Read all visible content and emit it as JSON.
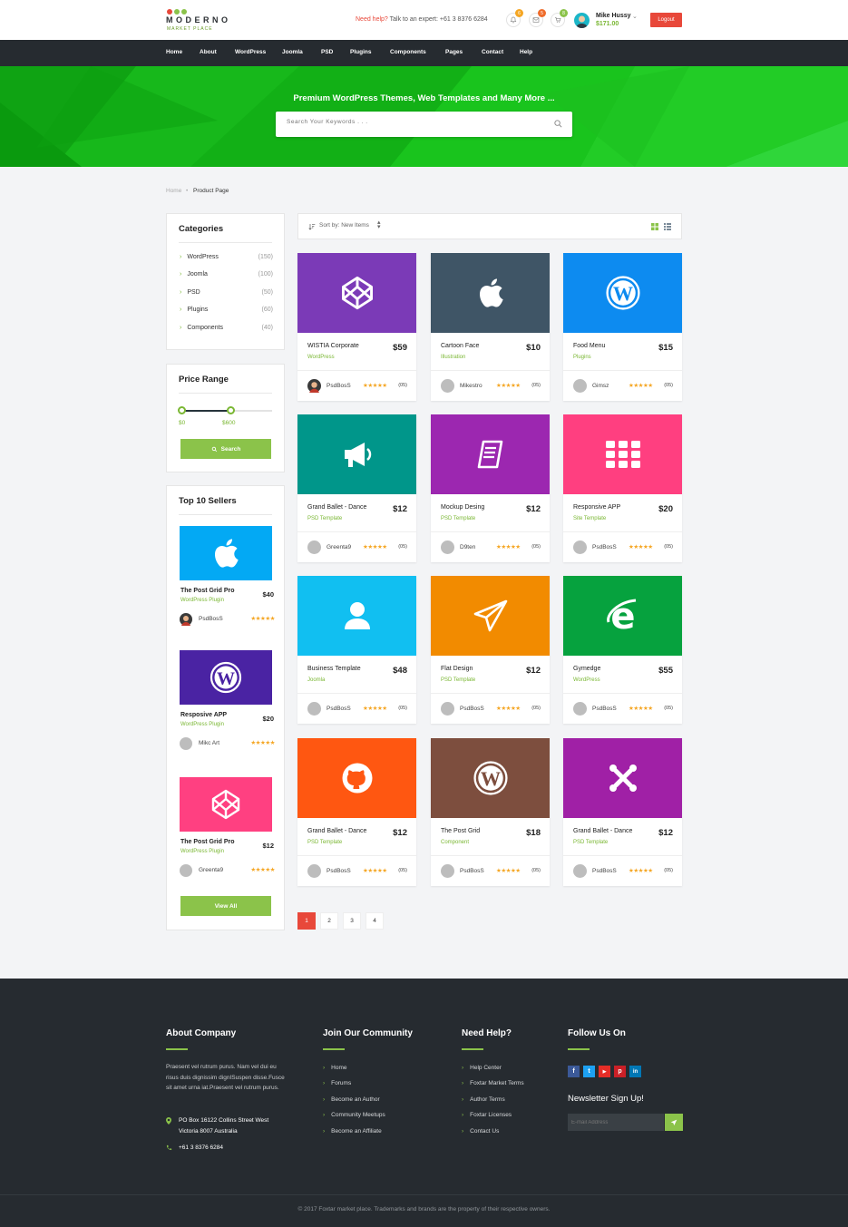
{
  "logo": {
    "title": "MODERNO",
    "subtitle": "MARKET PLACE",
    "dot_colors": [
      "#e8483a",
      "#8bc34a",
      "#8bc34a"
    ]
  },
  "header": {
    "help_prefix": "Need help?",
    "help_text": "Talk to an expert: +61 3 8376 6284",
    "notifications": [
      {
        "icon": "bell-icon",
        "badge": "6",
        "color": "#f5a623"
      },
      {
        "icon": "mail-icon",
        "badge": "5",
        "color": "#ef6c2b"
      },
      {
        "icon": "cart-icon",
        "badge": "8",
        "color": "#8bc34a"
      }
    ],
    "user_name": "Mike Hussy",
    "user_balance": "$171.00",
    "logout_label": "Logout"
  },
  "nav": [
    "Home",
    "About",
    "WordPress",
    "Joomla",
    "PSD",
    "Plugins",
    "Components",
    "Pages",
    "Contact",
    "Help"
  ],
  "hero": {
    "title": "Premium WordPress Themes, Web Templates and Many More ...",
    "search_placeholder": "Search Your Keywords . . ."
  },
  "breadcrumb": {
    "home": "Home",
    "current": "Product Page"
  },
  "categories": {
    "title": "Categories",
    "items": [
      {
        "label": "WordPress",
        "count": "(150)"
      },
      {
        "label": "Joomla",
        "count": "(100)"
      },
      {
        "label": "PSD",
        "count": "(50)"
      },
      {
        "label": "Plugins",
        "count": "(60)"
      },
      {
        "label": "Components",
        "count": "(40)"
      }
    ]
  },
  "price_range": {
    "title": "Price Range",
    "min_label": "$0",
    "max_label": "$600",
    "selected_fraction": 0.5,
    "button": "Search"
  },
  "top_sellers": {
    "title": "Top 10 Sellers",
    "items": [
      {
        "name": "The Post Grid Pro",
        "type": "WordPress Plugin",
        "price": "$40",
        "author": "PsdBosS",
        "color": "#03a9f4",
        "icon": "apple-icon",
        "stars": "★★★★★"
      },
      {
        "name": "Resposive APP",
        "type": "WordPress Plugin",
        "price": "$20",
        "author": "Mikc Art",
        "color": "#4a23a3",
        "icon": "wordpress-icon",
        "stars": "★★★★★"
      },
      {
        "name": "The Post Grid Pro",
        "type": "WordPress Plugin",
        "price": "$12",
        "author": "Greenta9",
        "color": "#ff4081",
        "icon": "codepen-icon",
        "stars": "★★★★★"
      }
    ],
    "button": "View All"
  },
  "sortbar": {
    "label": "Sort by: New Items"
  },
  "products": [
    {
      "name": "WISTIA Corporate",
      "type": "WordPress",
      "price": "$59",
      "author": "PsdBosS",
      "count": "05",
      "color": "#7b3ab7",
      "icon": "codepen-icon",
      "stars": "★★★★★"
    },
    {
      "name": "Cartoon Face",
      "type": "Illustration",
      "price": "$10",
      "author": "Mikestro",
      "count": "05",
      "color": "#3f5566",
      "icon": "apple-icon",
      "stars": "★★★★★"
    },
    {
      "name": "Food Menu",
      "type": "Plugins",
      "price": "$15",
      "author": "Gimsz",
      "count": "05",
      "color": "#0d8bf0",
      "icon": "wordpress-icon",
      "stars": "★★★★★"
    },
    {
      "name": "Grand Ballet - Dance",
      "type": "PSD Template",
      "price": "$12",
      "author": "Greenta9",
      "count": "05",
      "color": "#00968a",
      "icon": "megaphone-icon",
      "stars": "★★★★★"
    },
    {
      "name": "Mockup Desing",
      "type": "PSD Template",
      "price": "$12",
      "author": "D9ten",
      "count": "05",
      "color": "#9c27b0",
      "icon": "book-icon",
      "stars": "★★★★★"
    },
    {
      "name": "Responsive APP",
      "type": "Site Template",
      "price": "$20",
      "author": "PsdBosS",
      "count": "05",
      "color": "#ff3f80",
      "icon": "grid-icon",
      "stars": "★★★★★"
    },
    {
      "name": "Business Template",
      "type": "Joomla",
      "price": "$48",
      "author": "PsdBosS",
      "count": "05",
      "color": "#11bff1",
      "icon": "user-icon",
      "stars": "★★★★★"
    },
    {
      "name": "Flat Design",
      "type": "PSD Template",
      "price": "$12",
      "author": "PsdBosS",
      "count": "05",
      "color": "#f28b00",
      "icon": "paper-plane-icon",
      "stars": "★★★★★"
    },
    {
      "name": "Gymedge",
      "type": "WordPress",
      "price": "$55",
      "author": "PsdBosS",
      "count": "05",
      "color": "#06a23e",
      "icon": "ie-icon",
      "stars": "★★★★★"
    },
    {
      "name": "Grand Ballet - Dance",
      "type": "PSD Template",
      "price": "$12",
      "author": "PsdBosS",
      "count": "05",
      "color": "#ff5711",
      "icon": "github-icon",
      "stars": "★★★★★"
    },
    {
      "name": "The Post Grid",
      "type": "Component",
      "price": "$18",
      "author": "PsdBosS",
      "count": "05",
      "color": "#7d4e3e",
      "icon": "wordpress-icon",
      "stars": "★★★★★"
    },
    {
      "name": "Grand Ballet - Dance",
      "type": "PSD Template",
      "price": "$12",
      "author": "PsdBosS",
      "count": "05",
      "color": "#a020a6",
      "icon": "joomla-icon",
      "stars": "★★★★★"
    }
  ],
  "pagination": [
    "1",
    "2",
    "3",
    "4"
  ],
  "footer": {
    "about": {
      "title": "About Company",
      "text": "Praesent vel rutrum purus. Nam vel dui eu risus duis dignissim dignISuspen disse.Fusce sit amet urna iat.Praesent vel rutrum purus.",
      "address_line1": "PO Box 16122 Collins Street West",
      "address_line2": "Victoria 8007 Australia",
      "phone": "+61 3 8376 6284"
    },
    "community": {
      "title": "Join Our Community",
      "links": [
        "Home",
        "Forums",
        "Become an Author",
        "Community Meetups",
        "Become an Affiliate"
      ]
    },
    "help": {
      "title": "Need Help?",
      "links": [
        "Help Center",
        "Foxtar Market Terms",
        "Author Terms",
        "Foxtar Licenses",
        "Contact Us"
      ]
    },
    "follow": {
      "title": "Follow Us On",
      "newsletter_title": "Newsletter Sign Up!",
      "email_placeholder": "E-mail Address",
      "socials": [
        {
          "icon": "facebook-icon",
          "glyph": "f",
          "color": "#3b5998"
        },
        {
          "icon": "twitter-icon",
          "glyph": "t",
          "color": "#1da1f2"
        },
        {
          "icon": "youtube-icon",
          "glyph": "▶",
          "color": "#e52d27"
        },
        {
          "icon": "pinterest-icon",
          "glyph": "p",
          "color": "#cb2027"
        },
        {
          "icon": "linkedin-icon",
          "glyph": "in",
          "color": "#0077b5"
        }
      ]
    },
    "copyright": "© 2017 Foxtar market place. Trademarks and brands are the property of their respective owners."
  }
}
